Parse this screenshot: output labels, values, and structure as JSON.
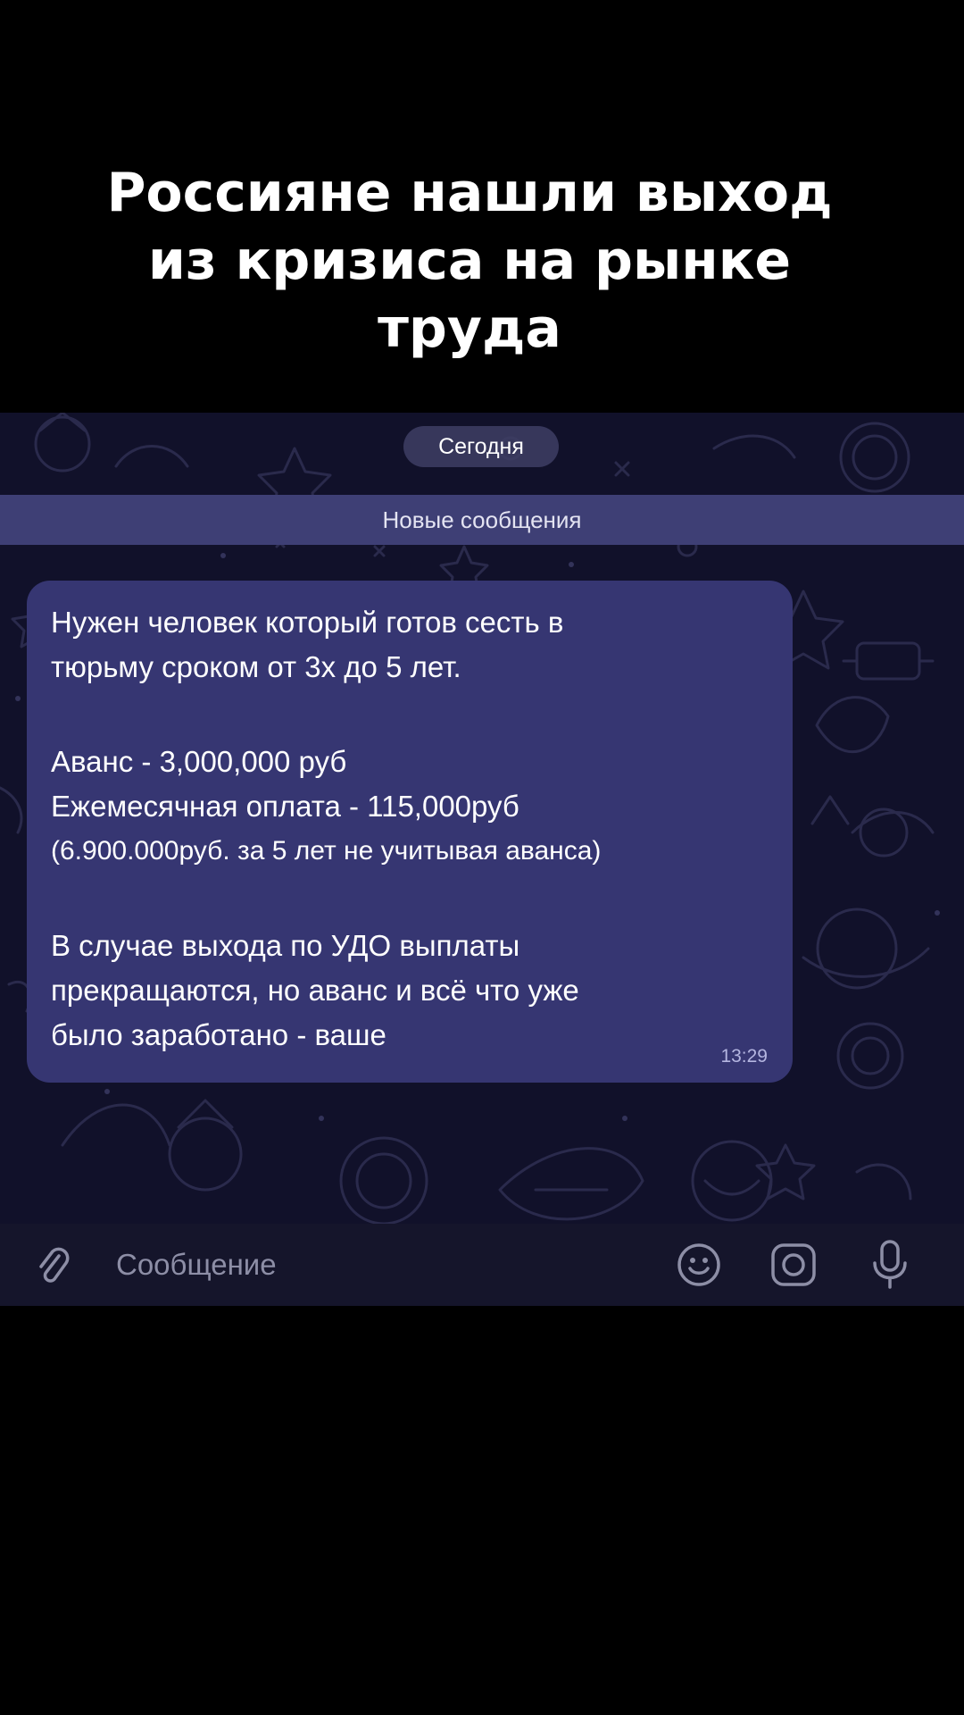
{
  "headline": {
    "line1": "Россияне нашли выход",
    "line2": "из кризиса на рынке",
    "line3": "труда"
  },
  "chat": {
    "date_label": "Сегодня",
    "new_messages_label": "Новые сообщения",
    "message": {
      "lines": [
        "Нужен человек который готов сесть в",
        "тюрьму сроком от 3х до 5 лет.",
        "Аванс - 3,000,000 руб",
        "Ежемесячная оплата - 115,000руб",
        "(6.900.000руб. за 5 лет не учитывая аванса)",
        "В случае выхода по УДО выплаты",
        "прекращаются, но аванс и всё что уже",
        "было заработано - ваше"
      ],
      "time": "13:29"
    }
  },
  "input_bar": {
    "placeholder": "Сообщение",
    "icons": {
      "attach": "paperclip-icon",
      "emoji": "smiley-icon",
      "camera": "camera-icon",
      "microphone": "microphone-icon"
    }
  },
  "colors": {
    "chat_background": "#11112a",
    "bubble": "#363672",
    "new_messages_bar": "#3e3f75",
    "date_pill": "#3e3e64",
    "input_bar": "#15152b",
    "icon": "#8d8ea6"
  }
}
